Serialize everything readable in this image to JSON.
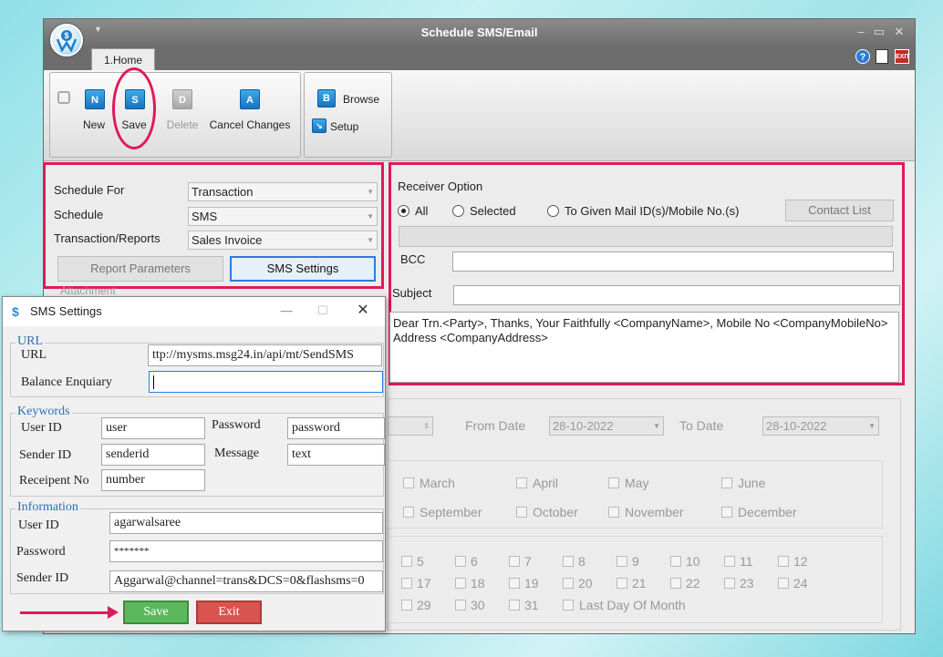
{
  "window": {
    "title": "Schedule SMS/Email",
    "home_tab": "1.Home"
  },
  "ribbon": {
    "new_label": "New",
    "save_label": "Save",
    "delete_label": "Delete",
    "cancel_label": "Cancel Changes",
    "browse_label": "Browse",
    "setup_label": "Setup",
    "icon_new": "N",
    "icon_save": "S",
    "icon_delete": "D",
    "icon_cancel": "A",
    "icon_browse": "B"
  },
  "schedule": {
    "schedule_for_label": "Schedule For",
    "schedule_for_value": "Transaction",
    "schedule_label": "Schedule",
    "schedule_value": "SMS",
    "transaction_label": "Transaction/Reports",
    "transaction_value": "Sales Invoice",
    "report_params_button": "Report Parameters",
    "sms_settings_button": "SMS Settings",
    "attachment_label": "Attachment"
  },
  "receiver": {
    "title": "Receiver Option",
    "opt_all": "All",
    "opt_selected": "Selected",
    "opt_given": "To Given Mail ID(s)/Mobile No.(s)",
    "selected_option": "All",
    "contact_list_button": "Contact List",
    "bcc_label": "BCC",
    "subject_label": "Subject",
    "message": "Dear Trn.<Party>, Thanks, Your Faithfully <CompanyName>, Mobile No <CompanyMobileNo> Address <CompanyAddress>"
  },
  "dates": {
    "from_label": "From Date",
    "from_value": "28-10-2022",
    "to_label": "To Date",
    "to_value": "28-10-2022"
  },
  "months_row1": [
    "March",
    "April",
    "May",
    "June"
  ],
  "months_row2": [
    "September",
    "October",
    "November",
    "December"
  ],
  "days_row1": [
    "5",
    "6",
    "7",
    "8",
    "9",
    "10",
    "11",
    "12"
  ],
  "days_row2": [
    "17",
    "18",
    "19",
    "20",
    "21",
    "22",
    "23",
    "24"
  ],
  "days_row3": [
    "29",
    "30",
    "31",
    "Last Day Of Month"
  ],
  "sms_dialog": {
    "title": "SMS Settings",
    "url_group": "URL",
    "url_label": "URL",
    "url_value": "ttp://mysms.msg24.in/api/mt/SendSMS",
    "balance_label": "Balance Enquiary",
    "balance_value": "",
    "keywords_group": "Keywords",
    "kw_user_label": "User ID",
    "kw_user_value": "user",
    "kw_password_label": "Password",
    "kw_password_value": "password",
    "kw_sender_label": "Sender ID",
    "kw_sender_value": "senderid",
    "kw_message_label": "Message",
    "kw_message_value": "text",
    "kw_receipent_label": "Receipent No",
    "kw_receipent_value": "number",
    "info_group": "Information",
    "info_user_label": "User ID",
    "info_user_value": "agarwalsaree",
    "info_password_label": "Password",
    "info_password_value": "*******",
    "info_sender_label": "Sender ID",
    "info_sender_value": "Aggarwal@channel=trans&DCS=0&flashsms=0",
    "save_button": "Save",
    "exit_button": "Exit"
  },
  "colors": {
    "highlight": "#e0195a",
    "save_green": "#5cb85c",
    "exit_red": "#d9534f",
    "group_title": "#2a6fb5"
  }
}
